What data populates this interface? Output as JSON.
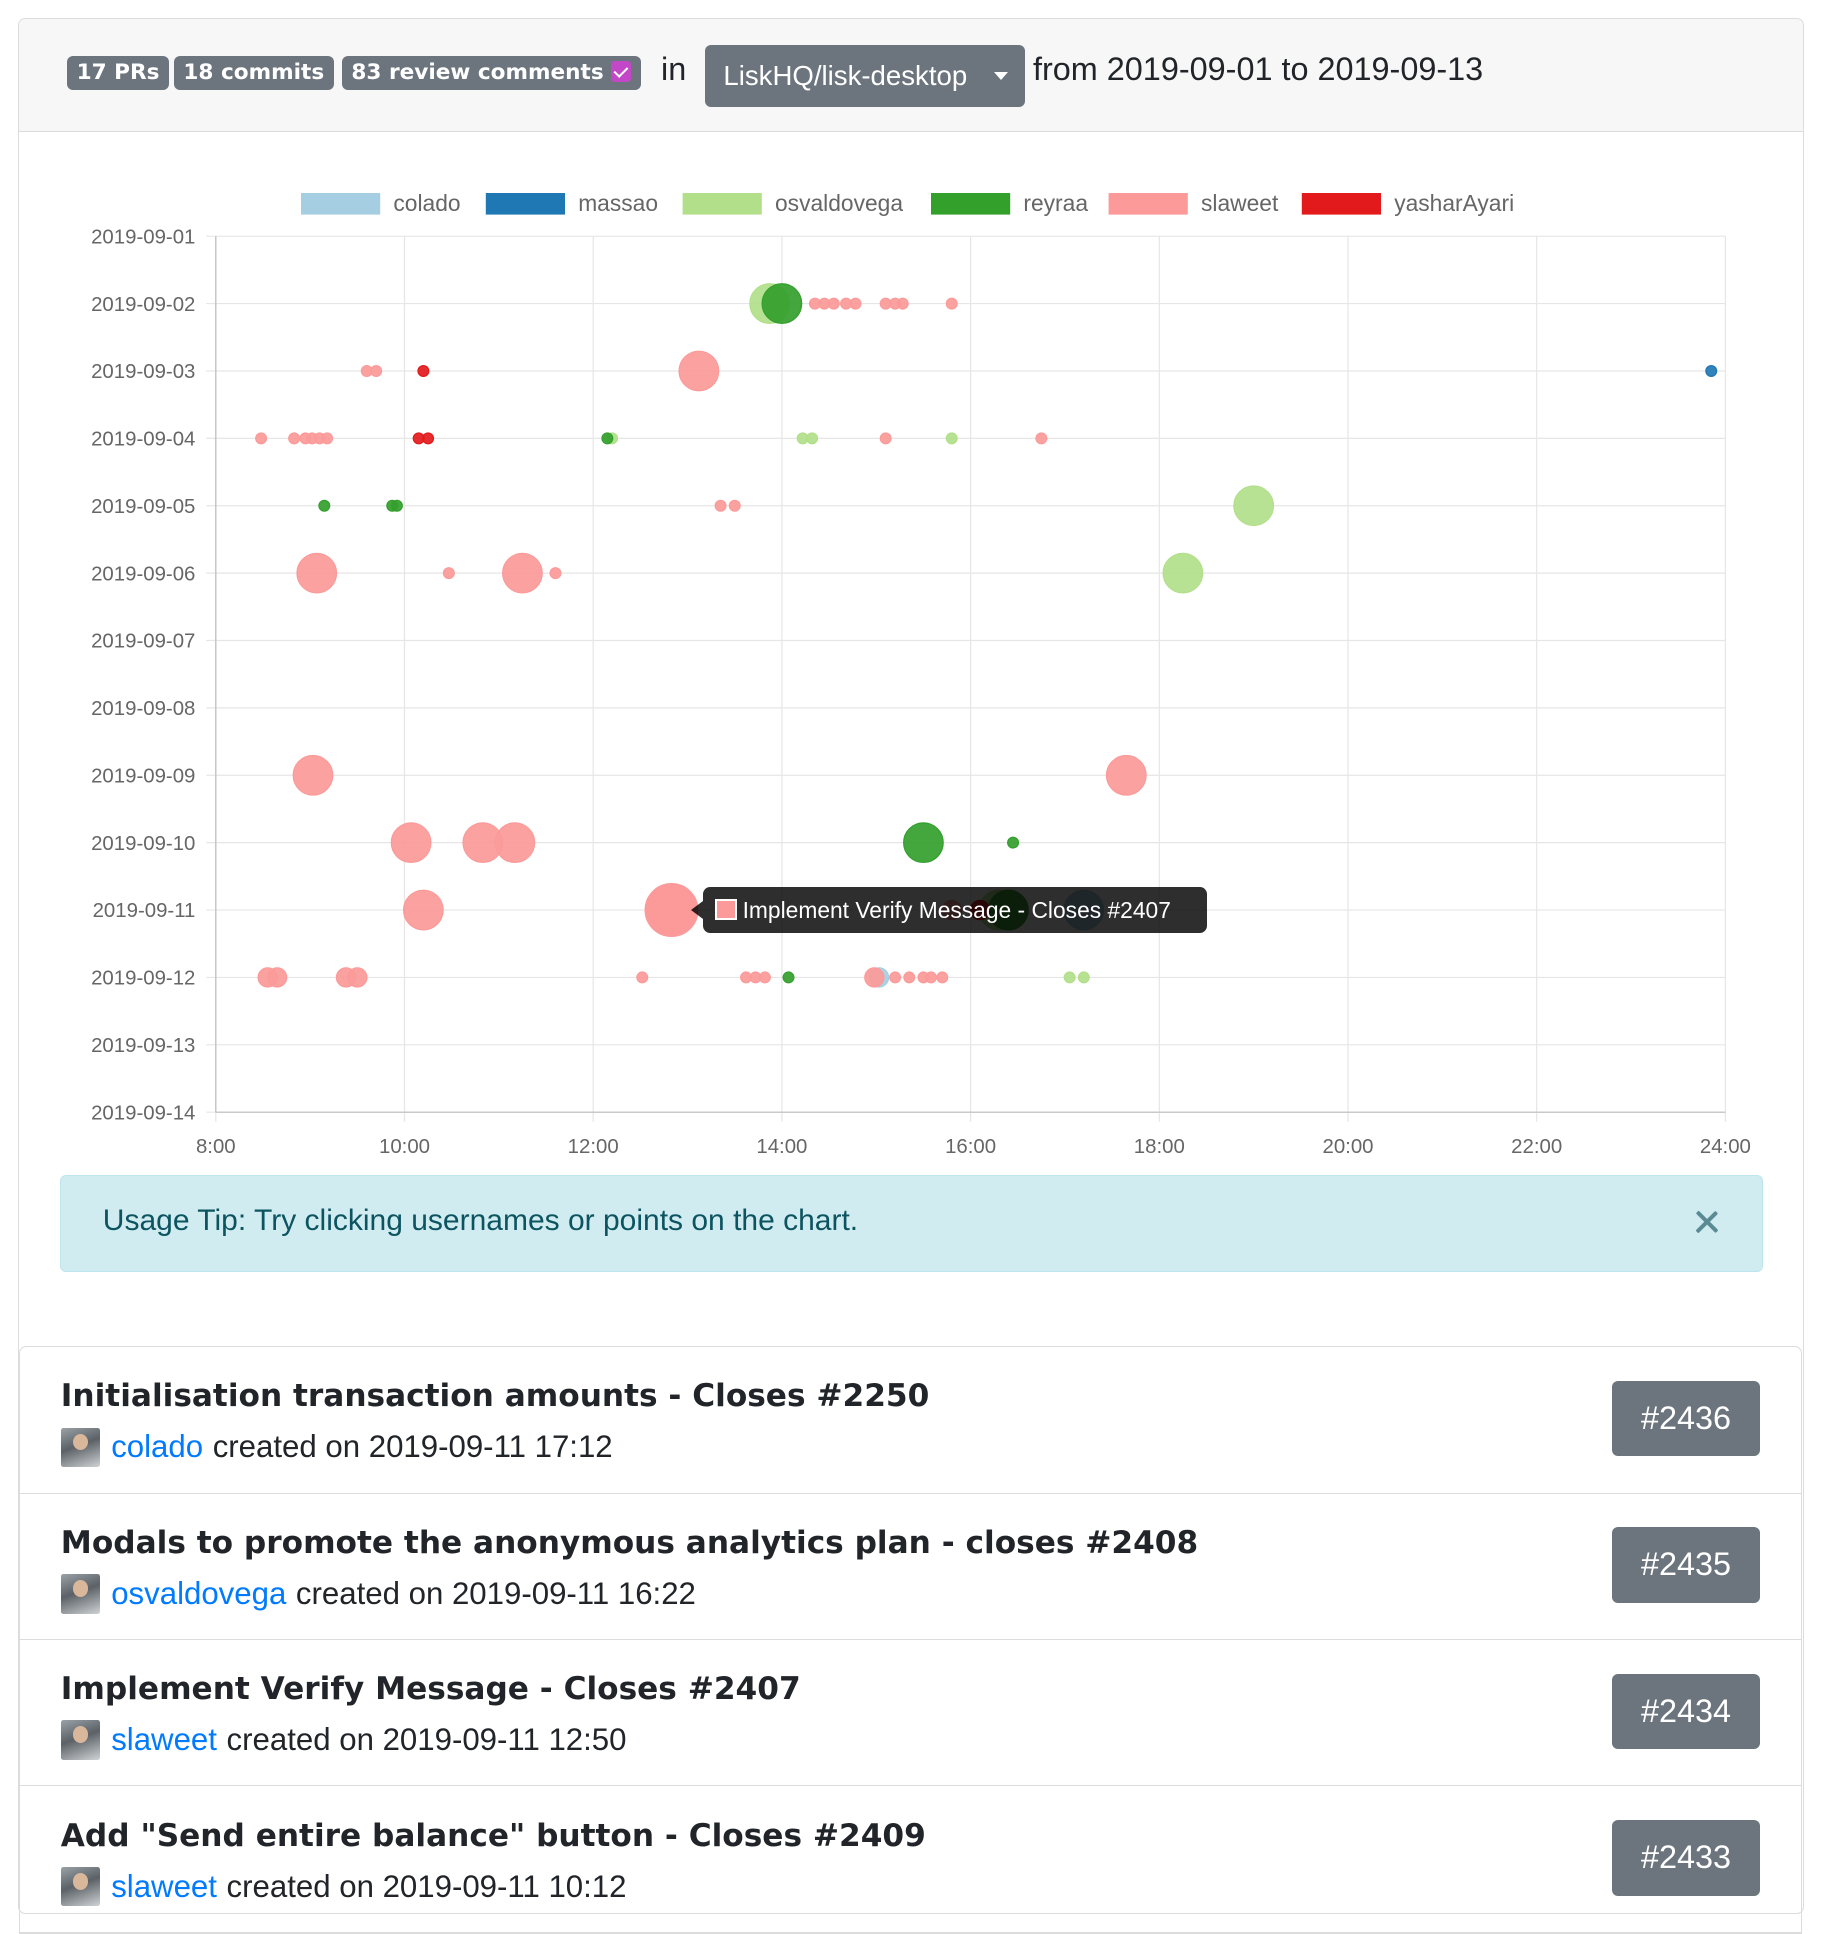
{
  "header": {
    "prs_badge": "17 PRs",
    "commits_badge": "18 commits",
    "review_badge": "83 review comments",
    "in_text": "in",
    "repo": "LiskHQ/lisk-desktop",
    "date_range": "from 2019-09-01 to 2019-09-13"
  },
  "tooltip": {
    "text": "Implement Verify Message - Closes #2407",
    "color": "#fb9a99"
  },
  "usage_tip": {
    "text": "Usage Tip: Try clicking usernames or points on the chart."
  },
  "pull_requests": [
    {
      "title": "Initialisation transaction amounts - Closes #2250",
      "author": "colado",
      "created": "created on 2019-09-11 17:12",
      "number": "#2436"
    },
    {
      "title": "Modals to promote the anonymous analytics plan - closes #2408",
      "author": "osvaldovega",
      "created": "created on 2019-09-11 16:22",
      "number": "#2435"
    },
    {
      "title": "Implement Verify Message - Closes #2407",
      "author": "slaweet",
      "created": "created on 2019-09-11 12:50",
      "number": "#2434"
    },
    {
      "title": "Add \"Send entire balance\" button - Closes #2409",
      "author": "slaweet",
      "created": "created on 2019-09-11 10:12",
      "number": "#2433"
    }
  ],
  "chart_data": {
    "type": "scatter",
    "x_ticks": [
      "8:00",
      "10:00",
      "12:00",
      "14:00",
      "16:00",
      "18:00",
      "20:00",
      "22:00",
      "24:00"
    ],
    "xlim": [
      8,
      24
    ],
    "y_ticks": [
      "2019-09-01",
      "2019-09-02",
      "2019-09-03",
      "2019-09-04",
      "2019-09-05",
      "2019-09-06",
      "2019-09-07",
      "2019-09-08",
      "2019-09-09",
      "2019-09-10",
      "2019-09-11",
      "2019-09-12",
      "2019-09-13",
      "2019-09-14"
    ],
    "grid": true,
    "legend_position": "top",
    "series": [
      {
        "name": "colado",
        "color": "#a6cee3",
        "points": [
          {
            "date": "2019-09-12",
            "time": 15.03,
            "size": "s"
          },
          {
            "date": "2019-09-11",
            "time": 17.2,
            "size": "l"
          }
        ]
      },
      {
        "name": "massao",
        "color": "#1f78b4",
        "points": [
          {
            "date": "2019-09-03",
            "time": 23.85,
            "size": "xs"
          }
        ]
      },
      {
        "name": "osvaldovega",
        "color": "#b2df8a",
        "points": [
          {
            "date": "2019-09-02",
            "time": 13.87,
            "size": "l"
          },
          {
            "date": "2019-09-04",
            "time": 12.2,
            "size": "xs"
          },
          {
            "date": "2019-09-04",
            "time": 14.22,
            "size": "xs"
          },
          {
            "date": "2019-09-04",
            "time": 14.32,
            "size": "xs"
          },
          {
            "date": "2019-09-04",
            "time": 15.8,
            "size": "xs"
          },
          {
            "date": "2019-09-05",
            "time": 19.0,
            "size": "l"
          },
          {
            "date": "2019-09-06",
            "time": 18.25,
            "size": "l"
          },
          {
            "date": "2019-09-11",
            "time": 16.3,
            "size": "l"
          },
          {
            "date": "2019-09-12",
            "time": 17.05,
            "size": "xs"
          },
          {
            "date": "2019-09-12",
            "time": 17.2,
            "size": "xs"
          }
        ]
      },
      {
        "name": "reyraa",
        "color": "#33a02c",
        "points": [
          {
            "date": "2019-09-02",
            "time": 14.0,
            "size": "l"
          },
          {
            "date": "2019-09-04",
            "time": 12.15,
            "size": "xs"
          },
          {
            "date": "2019-09-05",
            "time": 9.15,
            "size": "xs"
          },
          {
            "date": "2019-09-05",
            "time": 9.87,
            "size": "xs"
          },
          {
            "date": "2019-09-05",
            "time": 9.92,
            "size": "xs"
          },
          {
            "date": "2019-09-10",
            "time": 15.5,
            "size": "l"
          },
          {
            "date": "2019-09-10",
            "time": 16.45,
            "size": "xs"
          },
          {
            "date": "2019-09-11",
            "time": 16.4,
            "size": "l"
          },
          {
            "date": "2019-09-12",
            "time": 14.07,
            "size": "xs"
          }
        ]
      },
      {
        "name": "slaweet",
        "color": "#fb9a99",
        "points": [
          {
            "date": "2019-09-02",
            "time": 14.35,
            "size": "xs"
          },
          {
            "date": "2019-09-02",
            "time": 14.45,
            "size": "xs"
          },
          {
            "date": "2019-09-02",
            "time": 14.55,
            "size": "xs"
          },
          {
            "date": "2019-09-02",
            "time": 14.68,
            "size": "xs"
          },
          {
            "date": "2019-09-02",
            "time": 14.78,
            "size": "xs"
          },
          {
            "date": "2019-09-02",
            "time": 15.1,
            "size": "xs"
          },
          {
            "date": "2019-09-02",
            "time": 15.2,
            "size": "xs"
          },
          {
            "date": "2019-09-02",
            "time": 15.28,
            "size": "xs"
          },
          {
            "date": "2019-09-02",
            "time": 15.8,
            "size": "xs"
          },
          {
            "date": "2019-09-03",
            "time": 9.6,
            "size": "xs"
          },
          {
            "date": "2019-09-03",
            "time": 9.7,
            "size": "xs"
          },
          {
            "date": "2019-09-03",
            "time": 13.12,
            "size": "l"
          },
          {
            "date": "2019-09-04",
            "time": 8.48,
            "size": "xs"
          },
          {
            "date": "2019-09-04",
            "time": 8.83,
            "size": "xs"
          },
          {
            "date": "2019-09-04",
            "time": 8.95,
            "size": "xs"
          },
          {
            "date": "2019-09-04",
            "time": 9.02,
            "size": "xs"
          },
          {
            "date": "2019-09-04",
            "time": 9.1,
            "size": "xs"
          },
          {
            "date": "2019-09-04",
            "time": 9.18,
            "size": "xs"
          },
          {
            "date": "2019-09-04",
            "time": 15.1,
            "size": "xs"
          },
          {
            "date": "2019-09-04",
            "time": 16.75,
            "size": "xs"
          },
          {
            "date": "2019-09-05",
            "time": 13.35,
            "size": "xs"
          },
          {
            "date": "2019-09-05",
            "time": 13.5,
            "size": "xs"
          },
          {
            "date": "2019-09-06",
            "time": 9.07,
            "size": "l"
          },
          {
            "date": "2019-09-06",
            "time": 10.47,
            "size": "xs"
          },
          {
            "date": "2019-09-06",
            "time": 11.25,
            "size": "l"
          },
          {
            "date": "2019-09-06",
            "time": 11.6,
            "size": "xs"
          },
          {
            "date": "2019-09-09",
            "time": 9.03,
            "size": "l"
          },
          {
            "date": "2019-09-09",
            "time": 17.65,
            "size": "l"
          },
          {
            "date": "2019-09-10",
            "time": 10.07,
            "size": "l"
          },
          {
            "date": "2019-09-10",
            "time": 10.83,
            "size": "l"
          },
          {
            "date": "2019-09-10",
            "time": 11.17,
            "size": "l"
          },
          {
            "date": "2019-09-11",
            "time": 10.2,
            "size": "l"
          },
          {
            "date": "2019-09-11",
            "time": 12.83,
            "size": "xl"
          },
          {
            "date": "2019-09-11",
            "time": 15.8,
            "size": "s"
          },
          {
            "date": "2019-09-12",
            "time": 8.55,
            "size": "s"
          },
          {
            "date": "2019-09-12",
            "time": 8.65,
            "size": "s"
          },
          {
            "date": "2019-09-12",
            "time": 9.38,
            "size": "s"
          },
          {
            "date": "2019-09-12",
            "time": 9.5,
            "size": "s"
          },
          {
            "date": "2019-09-12",
            "time": 12.52,
            "size": "xs"
          },
          {
            "date": "2019-09-12",
            "time": 13.62,
            "size": "xs"
          },
          {
            "date": "2019-09-12",
            "time": 13.72,
            "size": "xs"
          },
          {
            "date": "2019-09-12",
            "time": 13.82,
            "size": "xs"
          },
          {
            "date": "2019-09-12",
            "time": 14.98,
            "size": "s"
          },
          {
            "date": "2019-09-12",
            "time": 15.2,
            "size": "xs"
          },
          {
            "date": "2019-09-12",
            "time": 15.35,
            "size": "xs"
          },
          {
            "date": "2019-09-12",
            "time": 15.5,
            "size": "xs"
          },
          {
            "date": "2019-09-12",
            "time": 15.58,
            "size": "xs"
          },
          {
            "date": "2019-09-12",
            "time": 15.7,
            "size": "xs"
          }
        ]
      },
      {
        "name": "yasharAyari",
        "color": "#e31a1c",
        "points": [
          {
            "date": "2019-09-03",
            "time": 10.2,
            "size": "xs"
          },
          {
            "date": "2019-09-04",
            "time": 10.15,
            "size": "xs"
          },
          {
            "date": "2019-09-04",
            "time": 10.25,
            "size": "xs"
          },
          {
            "date": "2019-09-11",
            "time": 16.1,
            "size": "s"
          }
        ]
      }
    ]
  }
}
